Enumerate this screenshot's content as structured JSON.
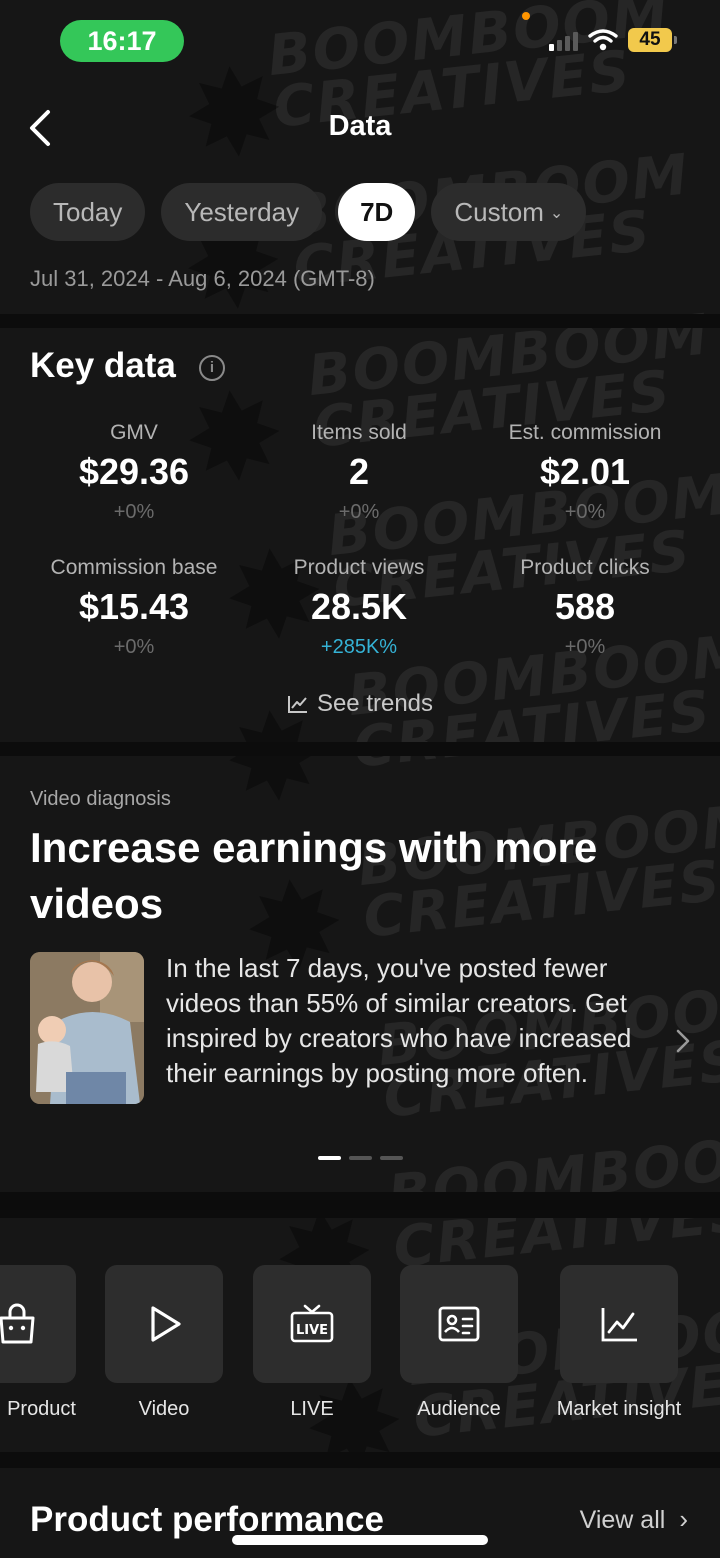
{
  "status": {
    "time": "16:17",
    "battery": "45"
  },
  "header": {
    "title": "Data"
  },
  "filters": {
    "tabs": [
      "Today",
      "Yesterday",
      "7D",
      "Custom"
    ],
    "active": "7D",
    "date_range": "Jul 31, 2024 - Aug 6, 2024 (GMT-8)"
  },
  "key_data": {
    "title": "Key data",
    "metrics": [
      {
        "label": "GMV",
        "value": "$29.36",
        "change": "+0%"
      },
      {
        "label": "Items sold",
        "value": "2",
        "change": "+0%"
      },
      {
        "label": "Est. commission",
        "value": "$2.01",
        "change": "+0%"
      },
      {
        "label": "Commission base",
        "value": "$15.43",
        "change": "+0%"
      },
      {
        "label": "Product views",
        "value": "28.5K",
        "change": "+285K%"
      },
      {
        "label": "Product clicks",
        "value": "588",
        "change": "+0%"
      }
    ],
    "see_trends": "See trends"
  },
  "video_diagnosis": {
    "label": "Video diagnosis",
    "headline": "Increase earnings with more videos",
    "body": "In the last 7 days, you've posted fewer videos than 55% of similar creators. Get inspired by creators who have increased their earnings by posting more often.",
    "slides": 3,
    "active_slide": 1
  },
  "shortcuts": [
    {
      "label": "Product",
      "icon": "shop-bag-icon"
    },
    {
      "label": "Video",
      "icon": "play-icon"
    },
    {
      "label": "LIVE",
      "icon": "live-tv-icon"
    },
    {
      "label": "Audience",
      "icon": "audience-card-icon"
    },
    {
      "label": "Market insight",
      "icon": "trend-chart-icon"
    }
  ],
  "product_performance": {
    "title": "Product performance",
    "view_all": "View all"
  },
  "watermark": {
    "line1": "BOOMBOOM",
    "line2": "CREATIVES"
  }
}
